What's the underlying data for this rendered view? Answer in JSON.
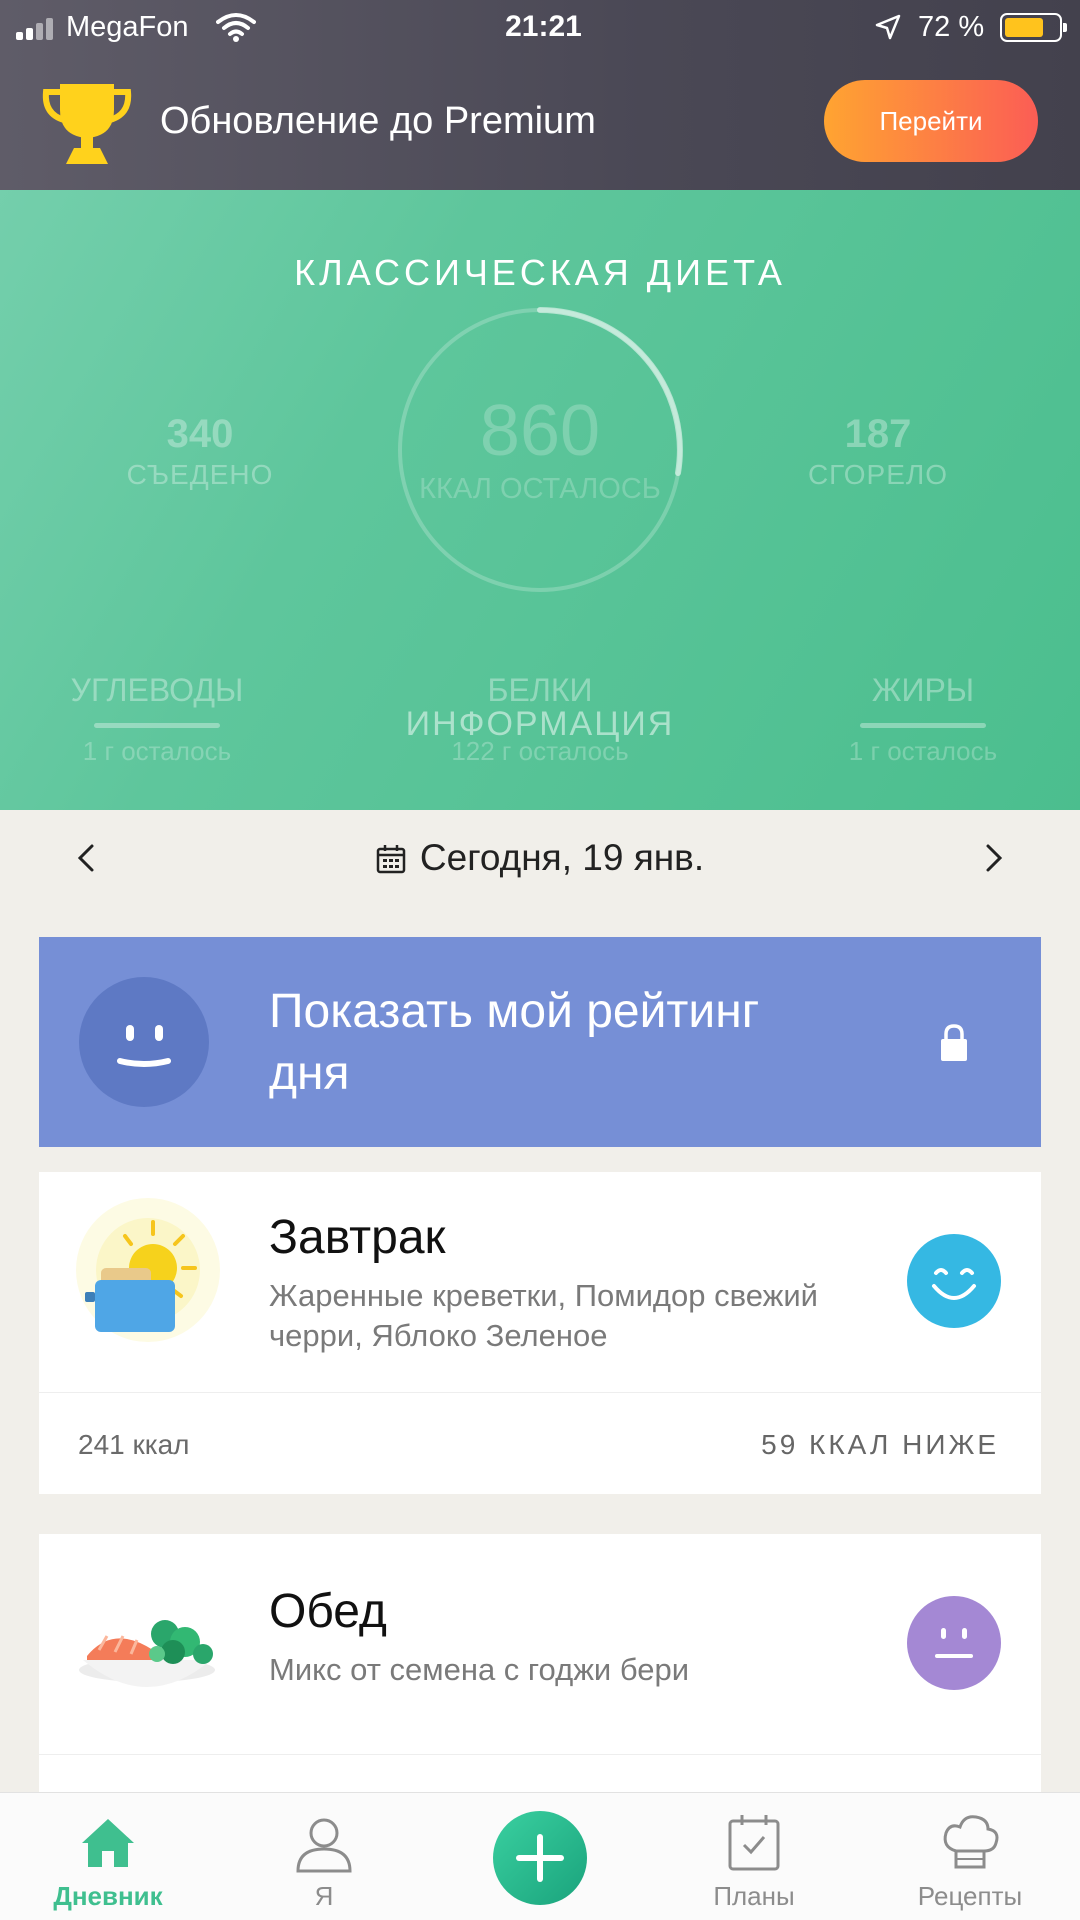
{
  "status_bar": {
    "carrier": "MegaFon",
    "time": "21:21",
    "battery": "72 %",
    "battery_level": 0.72
  },
  "premium": {
    "title": "Обновление до Premium",
    "button_label": "Перейти"
  },
  "diet": {
    "title": "КЛАССИЧЕСКАЯ ДИЕТА",
    "eaten": {
      "value": "340",
      "label": "СЪЕДЕНО"
    },
    "remaining": {
      "value": "860",
      "label": "ККАЛ ОСТАЛОСЬ"
    },
    "burned": {
      "value": "187",
      "label": "СГОРЕЛО"
    },
    "macros": [
      {
        "name": "УГЛЕВОДЫ",
        "left": "1 г осталось"
      },
      {
        "name": "БЕЛКИ",
        "left": "122 г осталось"
      },
      {
        "name": "ЖИРЫ",
        "left": "1 г осталось"
      }
    ],
    "info_label": "ИНФОРМАЦИЯ"
  },
  "date_nav": {
    "label": "Сегодня, 19 янв."
  },
  "rating": {
    "text": "Показать мой рейтинг дня"
  },
  "meals": [
    {
      "name": "Завтрак",
      "description": "Жаренные креветки, Помидор свежий черри, Яблоко Зеленое",
      "kcal": "241 ккал",
      "status": "59 ККАЛ НИЖЕ",
      "mood_color": "#35b8e3"
    },
    {
      "name": "Обед",
      "description": "Микс от семена с годжи бери",
      "mood_color": "#a488d4"
    }
  ],
  "nav": {
    "items": [
      {
        "label": "Дневник"
      },
      {
        "label": "Я"
      },
      {
        "label": "Планы"
      },
      {
        "label": "Рецепты"
      }
    ]
  },
  "colors": {
    "accent_green": "#3fbf8f",
    "rating_blue": "#768fd6",
    "premium_orange": "#fb7a45"
  }
}
